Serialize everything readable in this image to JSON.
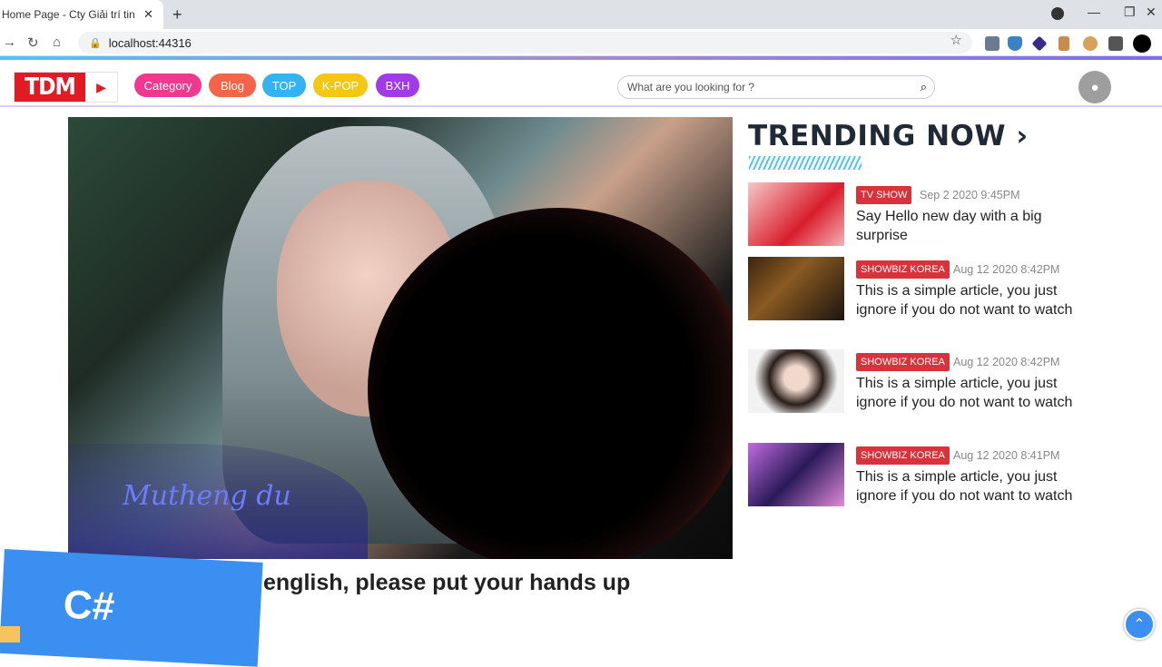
{
  "browser": {
    "tab_title": "Home Page - Cty Giải trí tin tức t",
    "tab_close": "✕",
    "new_tab": "+",
    "url": "localhost:44316"
  },
  "header": {
    "logo_text": "TDM",
    "nav": [
      "Category",
      "Blog",
      "TOP",
      "K-POP",
      "BXH"
    ],
    "nav_colors": [
      "#f0388f",
      "#f4634a",
      "#33b4f2",
      "#f3c712",
      "#a03be8"
    ],
    "search_placeholder": "What are you looking for ?"
  },
  "hero": {
    "title": "english, please put your hands up",
    "signature": "Mutheng du"
  },
  "badge": {
    "text": "C#"
  },
  "trending": {
    "title": "TRENDING NOW",
    "items": [
      {
        "tag": "TV SHOW",
        "date": "Sep 2 2020 9:45PM",
        "title": "Say Hello new day with a big surprise"
      },
      {
        "tag": "SHOWBIZ KOREA",
        "date": "Aug 12 2020 8:42PM",
        "title": "This is a simple article, you just ignore if you do not want to watch"
      },
      {
        "tag": "SHOWBIZ KOREA",
        "date": "Aug 12 2020 8:42PM",
        "title": "This is a simple article, you just ignore if you do not want to watch"
      },
      {
        "tag": "SHOWBIZ KOREA",
        "date": "Aug 12 2020 8:41PM",
        "title": "This is a simple article, you just ignore if you do not want to watch"
      }
    ]
  }
}
